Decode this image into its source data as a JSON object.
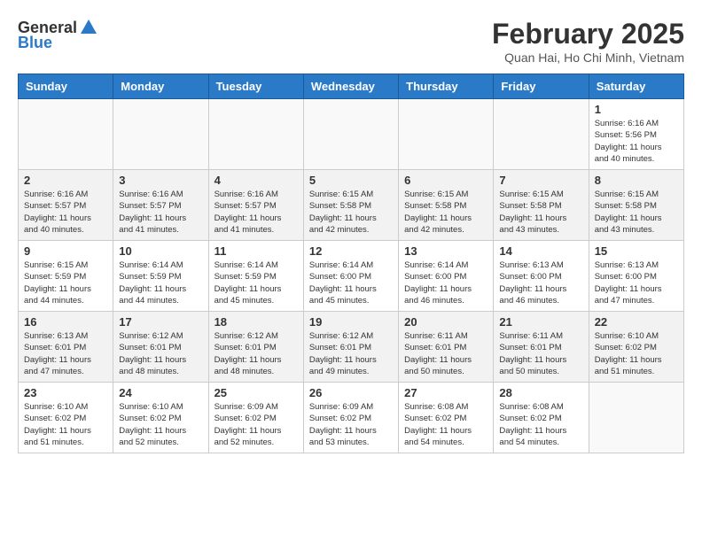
{
  "header": {
    "logo_general": "General",
    "logo_blue": "Blue",
    "month_title": "February 2025",
    "subtitle": "Quan Hai, Ho Chi Minh, Vietnam"
  },
  "weekdays": [
    "Sunday",
    "Monday",
    "Tuesday",
    "Wednesday",
    "Thursday",
    "Friday",
    "Saturday"
  ],
  "weeks": [
    [
      {
        "day": "",
        "info": ""
      },
      {
        "day": "",
        "info": ""
      },
      {
        "day": "",
        "info": ""
      },
      {
        "day": "",
        "info": ""
      },
      {
        "day": "",
        "info": ""
      },
      {
        "day": "",
        "info": ""
      },
      {
        "day": "1",
        "info": "Sunrise: 6:16 AM\nSunset: 5:56 PM\nDaylight: 11 hours and 40 minutes."
      }
    ],
    [
      {
        "day": "2",
        "info": "Sunrise: 6:16 AM\nSunset: 5:57 PM\nDaylight: 11 hours and 40 minutes."
      },
      {
        "day": "3",
        "info": "Sunrise: 6:16 AM\nSunset: 5:57 PM\nDaylight: 11 hours and 41 minutes."
      },
      {
        "day": "4",
        "info": "Sunrise: 6:16 AM\nSunset: 5:57 PM\nDaylight: 11 hours and 41 minutes."
      },
      {
        "day": "5",
        "info": "Sunrise: 6:15 AM\nSunset: 5:58 PM\nDaylight: 11 hours and 42 minutes."
      },
      {
        "day": "6",
        "info": "Sunrise: 6:15 AM\nSunset: 5:58 PM\nDaylight: 11 hours and 42 minutes."
      },
      {
        "day": "7",
        "info": "Sunrise: 6:15 AM\nSunset: 5:58 PM\nDaylight: 11 hours and 43 minutes."
      },
      {
        "day": "8",
        "info": "Sunrise: 6:15 AM\nSunset: 5:58 PM\nDaylight: 11 hours and 43 minutes."
      }
    ],
    [
      {
        "day": "9",
        "info": "Sunrise: 6:15 AM\nSunset: 5:59 PM\nDaylight: 11 hours and 44 minutes."
      },
      {
        "day": "10",
        "info": "Sunrise: 6:14 AM\nSunset: 5:59 PM\nDaylight: 11 hours and 44 minutes."
      },
      {
        "day": "11",
        "info": "Sunrise: 6:14 AM\nSunset: 5:59 PM\nDaylight: 11 hours and 45 minutes."
      },
      {
        "day": "12",
        "info": "Sunrise: 6:14 AM\nSunset: 6:00 PM\nDaylight: 11 hours and 45 minutes."
      },
      {
        "day": "13",
        "info": "Sunrise: 6:14 AM\nSunset: 6:00 PM\nDaylight: 11 hours and 46 minutes."
      },
      {
        "day": "14",
        "info": "Sunrise: 6:13 AM\nSunset: 6:00 PM\nDaylight: 11 hours and 46 minutes."
      },
      {
        "day": "15",
        "info": "Sunrise: 6:13 AM\nSunset: 6:00 PM\nDaylight: 11 hours and 47 minutes."
      }
    ],
    [
      {
        "day": "16",
        "info": "Sunrise: 6:13 AM\nSunset: 6:01 PM\nDaylight: 11 hours and 47 minutes."
      },
      {
        "day": "17",
        "info": "Sunrise: 6:12 AM\nSunset: 6:01 PM\nDaylight: 11 hours and 48 minutes."
      },
      {
        "day": "18",
        "info": "Sunrise: 6:12 AM\nSunset: 6:01 PM\nDaylight: 11 hours and 48 minutes."
      },
      {
        "day": "19",
        "info": "Sunrise: 6:12 AM\nSunset: 6:01 PM\nDaylight: 11 hours and 49 minutes."
      },
      {
        "day": "20",
        "info": "Sunrise: 6:11 AM\nSunset: 6:01 PM\nDaylight: 11 hours and 50 minutes."
      },
      {
        "day": "21",
        "info": "Sunrise: 6:11 AM\nSunset: 6:01 PM\nDaylight: 11 hours and 50 minutes."
      },
      {
        "day": "22",
        "info": "Sunrise: 6:10 AM\nSunset: 6:02 PM\nDaylight: 11 hours and 51 minutes."
      }
    ],
    [
      {
        "day": "23",
        "info": "Sunrise: 6:10 AM\nSunset: 6:02 PM\nDaylight: 11 hours and 51 minutes."
      },
      {
        "day": "24",
        "info": "Sunrise: 6:10 AM\nSunset: 6:02 PM\nDaylight: 11 hours and 52 minutes."
      },
      {
        "day": "25",
        "info": "Sunrise: 6:09 AM\nSunset: 6:02 PM\nDaylight: 11 hours and 52 minutes."
      },
      {
        "day": "26",
        "info": "Sunrise: 6:09 AM\nSunset: 6:02 PM\nDaylight: 11 hours and 53 minutes."
      },
      {
        "day": "27",
        "info": "Sunrise: 6:08 AM\nSunset: 6:02 PM\nDaylight: 11 hours and 54 minutes."
      },
      {
        "day": "28",
        "info": "Sunrise: 6:08 AM\nSunset: 6:02 PM\nDaylight: 11 hours and 54 minutes."
      },
      {
        "day": "",
        "info": ""
      }
    ]
  ]
}
